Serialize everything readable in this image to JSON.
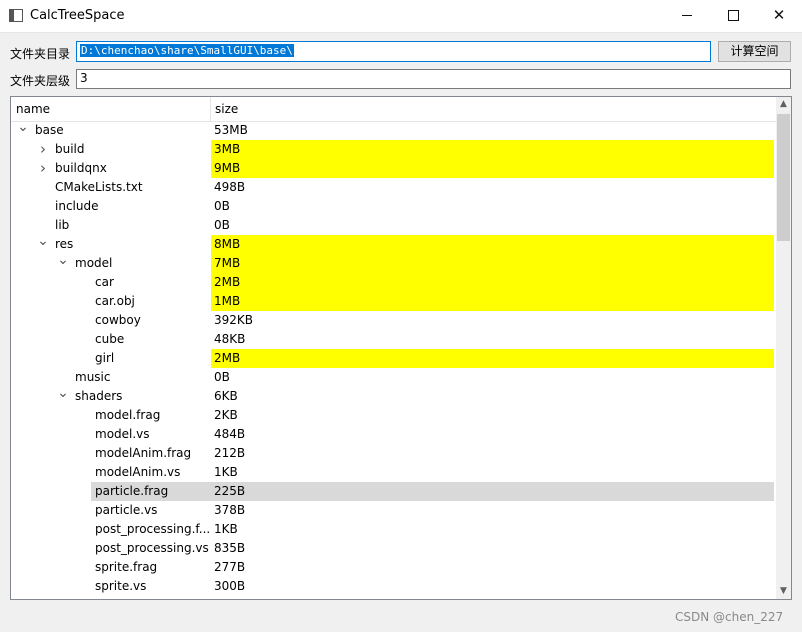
{
  "window": {
    "title": "CalcTreeSpace",
    "minimize_glyph": "",
    "close_glyph": "✕"
  },
  "form": {
    "dir_label": "文件夹目录",
    "dir_value": "D:\\chenchao\\share\\SmallGUI\\base\\",
    "calc_button": "计算空间",
    "depth_label": "文件夹层级",
    "depth_value": "3"
  },
  "colors": {
    "highlight": "#ffff00",
    "selected": "#d9d9d9",
    "focus": "#0078d7"
  },
  "tree": {
    "headers": {
      "name": "name",
      "size": "size"
    },
    "rows": [
      {
        "name": "base",
        "size": "53MB",
        "level": 0,
        "arrow": "expanded",
        "highlight": false
      },
      {
        "name": "build",
        "size": "3MB",
        "level": 1,
        "arrow": "collapsed",
        "highlight": true
      },
      {
        "name": "buildqnx",
        "size": "9MB",
        "level": 1,
        "arrow": "collapsed",
        "highlight": true
      },
      {
        "name": "CMakeLists.txt",
        "size": "498B",
        "level": 1,
        "arrow": "none",
        "highlight": false
      },
      {
        "name": "include",
        "size": "0B",
        "level": 1,
        "arrow": "none",
        "highlight": false
      },
      {
        "name": "lib",
        "size": "0B",
        "level": 1,
        "arrow": "none",
        "highlight": false
      },
      {
        "name": "res",
        "size": "8MB",
        "level": 1,
        "arrow": "expanded",
        "highlight": true
      },
      {
        "name": "model",
        "size": "7MB",
        "level": 2,
        "arrow": "expanded",
        "highlight": true
      },
      {
        "name": "car",
        "size": "2MB",
        "level": 3,
        "arrow": "none",
        "highlight": true
      },
      {
        "name": "car.obj",
        "size": "1MB",
        "level": 3,
        "arrow": "none",
        "highlight": true
      },
      {
        "name": "cowboy",
        "size": "392KB",
        "level": 3,
        "arrow": "none",
        "highlight": false
      },
      {
        "name": "cube",
        "size": "48KB",
        "level": 3,
        "arrow": "none",
        "highlight": false
      },
      {
        "name": "girl",
        "size": "2MB",
        "level": 3,
        "arrow": "none",
        "highlight": true
      },
      {
        "name": "music",
        "size": "0B",
        "level": 2,
        "arrow": "none",
        "highlight": false
      },
      {
        "name": "shaders",
        "size": "6KB",
        "level": 2,
        "arrow": "expanded",
        "highlight": false
      },
      {
        "name": "model.frag",
        "size": "2KB",
        "level": 3,
        "arrow": "none",
        "highlight": false
      },
      {
        "name": "model.vs",
        "size": "484B",
        "level": 3,
        "arrow": "none",
        "highlight": false
      },
      {
        "name": "modelAnim.frag",
        "size": "212B",
        "level": 3,
        "arrow": "none",
        "highlight": false
      },
      {
        "name": "modelAnim.vs",
        "size": "1KB",
        "level": 3,
        "arrow": "none",
        "highlight": false
      },
      {
        "name": "particle.frag",
        "size": "225B",
        "level": 3,
        "arrow": "none",
        "highlight": false,
        "selected": true
      },
      {
        "name": "particle.vs",
        "size": "378B",
        "level": 3,
        "arrow": "none",
        "highlight": false
      },
      {
        "name": "post_processing.f...",
        "size": "1KB",
        "level": 3,
        "arrow": "none",
        "highlight": false
      },
      {
        "name": "post_processing.vs",
        "size": "835B",
        "level": 3,
        "arrow": "none",
        "highlight": false
      },
      {
        "name": "sprite.frag",
        "size": "277B",
        "level": 3,
        "arrow": "none",
        "highlight": false
      },
      {
        "name": "sprite.vs",
        "size": "300B",
        "level": 3,
        "arrow": "none",
        "highlight": false
      }
    ]
  },
  "watermark": "CSDN @chen_227"
}
